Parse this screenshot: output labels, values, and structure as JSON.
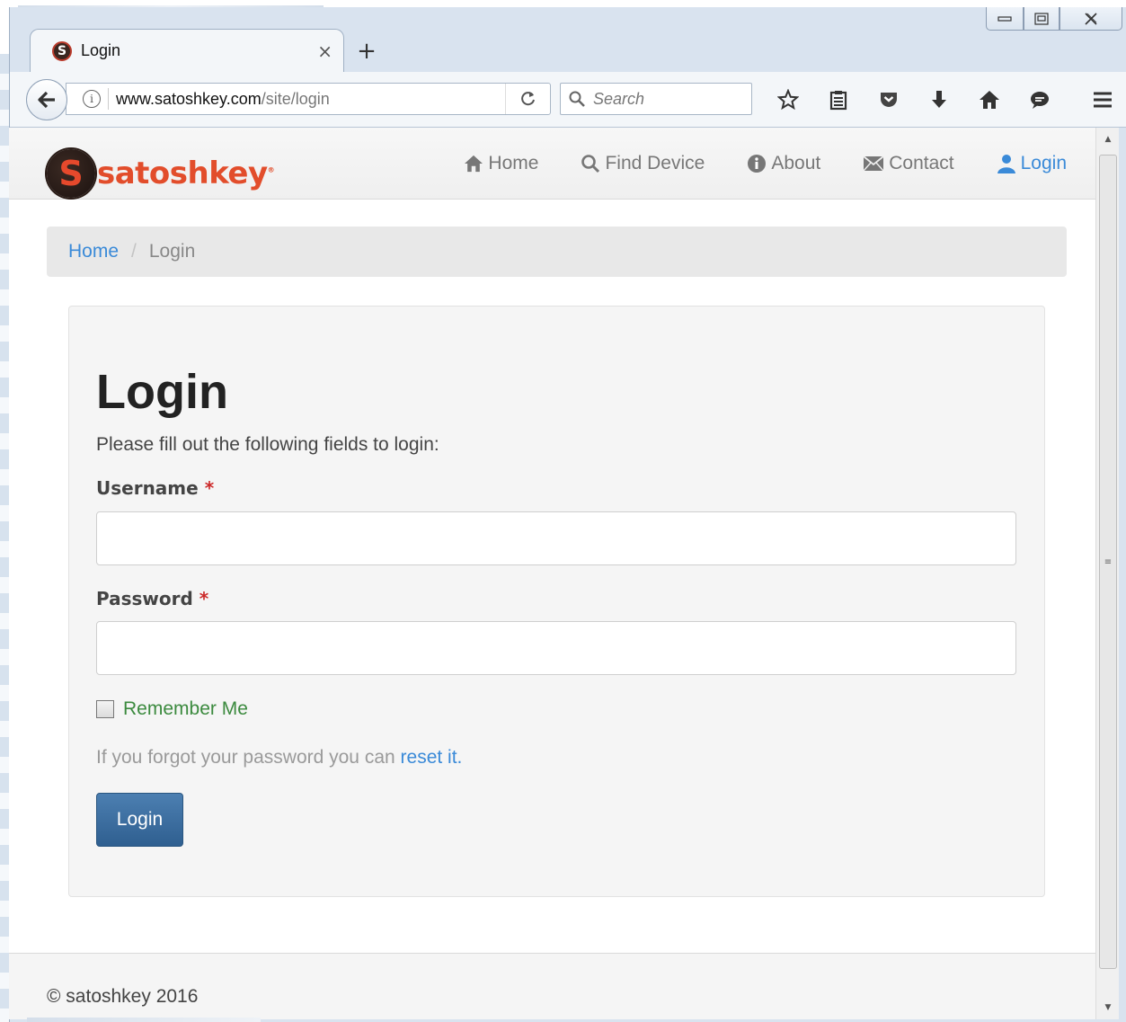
{
  "browser": {
    "tab_title": "Login",
    "tab_favicon_letter": "S",
    "url_host": "www.satoshkey.com",
    "url_path": "/site/login",
    "search_placeholder": "Search"
  },
  "site": {
    "brand": "satoshkey",
    "brand_mark": "®",
    "logo_letter": "S",
    "nav": [
      {
        "label": "Home",
        "icon": "home-icon"
      },
      {
        "label": "Find Device",
        "icon": "search-icon"
      },
      {
        "label": "About",
        "icon": "info-icon"
      },
      {
        "label": "Contact",
        "icon": "envelope-icon"
      },
      {
        "label": "Login",
        "icon": "user-icon"
      }
    ],
    "breadcrumb": {
      "home": "Home",
      "current": "Login"
    }
  },
  "login": {
    "title": "Login",
    "description": "Please fill out the following fields to login:",
    "username_label": "Username",
    "password_label": "Password",
    "required_mark": "*",
    "username_value": "",
    "password_value": "",
    "remember_label": "Remember Me",
    "remember_checked": false,
    "forgot_text": "If you forgot your password you can",
    "reset_link": "reset it.",
    "submit_label": "Login"
  },
  "footer": {
    "text": "© satoshkey 2016"
  },
  "colors": {
    "brand": "#e24d2b",
    "link": "#3a8ad8",
    "button": "#3b6b9c",
    "remember": "#3b8a3e"
  }
}
